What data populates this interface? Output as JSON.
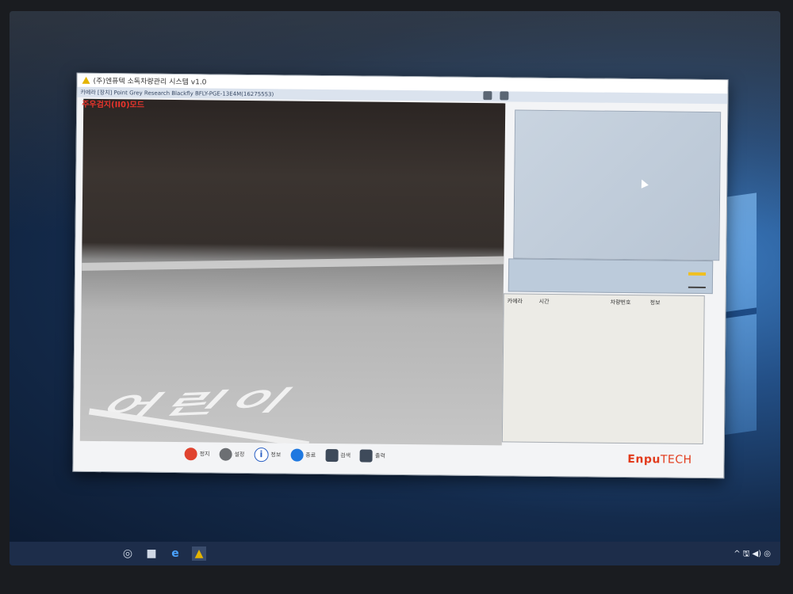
{
  "window": {
    "title": "(주)엔퓨텍 소독차량관리 시스템 v1.0",
    "camera_caption": "카메라 [장치] Point Grey Research Blackfly BFLY-PGE-13E4M(16275553)",
    "controls": [
      "–",
      "□",
      "×"
    ]
  },
  "video": {
    "mode_label": "주우검지(II0)모드",
    "road_marking": "어린이"
  },
  "table": {
    "headers": [
      "카메라",
      "시간",
      "차량번호",
      "정보"
    ]
  },
  "toolbar": [
    {
      "label": "정지",
      "icon": "stop-icon",
      "color": "#e0432f"
    },
    {
      "label": "설정",
      "icon": "gear-icon",
      "color": "#6c6f73"
    },
    {
      "label": "정보",
      "icon": "info-icon",
      "color": "#2a5fc4"
    },
    {
      "label": "종료",
      "icon": "power-icon",
      "color": "#1e78e0"
    },
    {
      "label": "검색",
      "icon": "search-icon",
      "color": "#3e4a5a"
    },
    {
      "label": "출력",
      "icon": "print-icon",
      "color": "#3e4a5a"
    }
  ],
  "brand": {
    "part1": "Enpu",
    "part2": "TECH"
  },
  "taskbar": {
    "icons": [
      "task-view-icon",
      "folder-icon",
      "edge-icon",
      "app-warning-icon"
    ],
    "tray": "^ 🖫 ◀) ◎"
  }
}
